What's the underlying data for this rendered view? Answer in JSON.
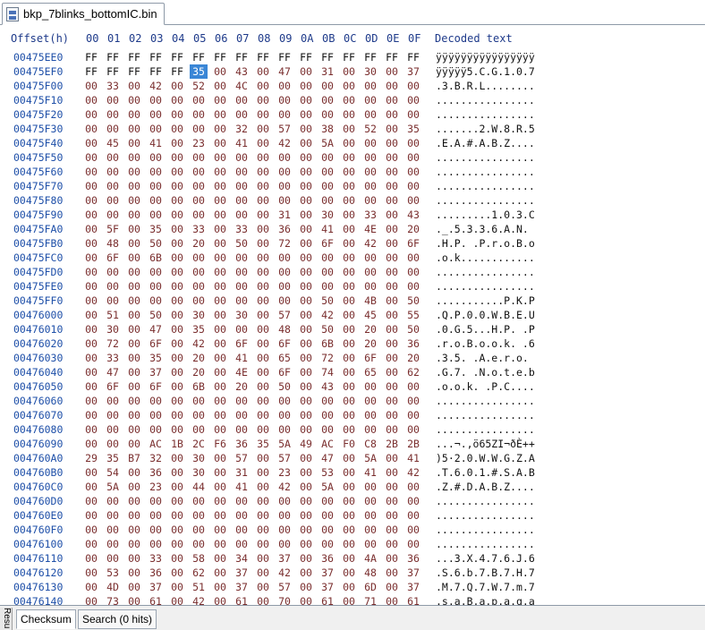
{
  "tab": {
    "title": "bkp_7blinks_bottomIC.bin",
    "icon": "binary-file-icon"
  },
  "header": {
    "offset_label": "Offset(h)",
    "columns": [
      "00",
      "01",
      "02",
      "03",
      "04",
      "05",
      "06",
      "07",
      "08",
      "09",
      "0A",
      "0B",
      "0C",
      "0D",
      "0E",
      "0F"
    ],
    "decoded_label": "Decoded text"
  },
  "selection": {
    "row": 1,
    "col": 5
  },
  "rows": [
    {
      "offset": "00475EE0",
      "bytes": "FF FF FF FF FF FF FF FF FF FF FF FF FF FF FF FF",
      "text": "ÿÿÿÿÿÿÿÿÿÿÿÿÿÿÿÿ"
    },
    {
      "offset": "00475EF0",
      "bytes": "FF FF FF FF FF 35 00 43 00 47 00 31 00 30 00 37",
      "text": "ÿÿÿÿÿ5.C.G.1.0.7"
    },
    {
      "offset": "00475F00",
      "bytes": "00 33 00 42 00 52 00 4C 00 00 00 00 00 00 00 00",
      "text": ".3.B.R.L........"
    },
    {
      "offset": "00475F10",
      "bytes": "00 00 00 00 00 00 00 00 00 00 00 00 00 00 00 00",
      "text": "................"
    },
    {
      "offset": "00475F20",
      "bytes": "00 00 00 00 00 00 00 00 00 00 00 00 00 00 00 00",
      "text": "................"
    },
    {
      "offset": "00475F30",
      "bytes": "00 00 00 00 00 00 00 32 00 57 00 38 00 52 00 35",
      "text": ".......2.W.8.R.5"
    },
    {
      "offset": "00475F40",
      "bytes": "00 45 00 41 00 23 00 41 00 42 00 5A 00 00 00 00",
      "text": ".E.A.#.A.B.Z...."
    },
    {
      "offset": "00475F50",
      "bytes": "00 00 00 00 00 00 00 00 00 00 00 00 00 00 00 00",
      "text": "................"
    },
    {
      "offset": "00475F60",
      "bytes": "00 00 00 00 00 00 00 00 00 00 00 00 00 00 00 00",
      "text": "................"
    },
    {
      "offset": "00475F70",
      "bytes": "00 00 00 00 00 00 00 00 00 00 00 00 00 00 00 00",
      "text": "................"
    },
    {
      "offset": "00475F80",
      "bytes": "00 00 00 00 00 00 00 00 00 00 00 00 00 00 00 00",
      "text": "................"
    },
    {
      "offset": "00475F90",
      "bytes": "00 00 00 00 00 00 00 00 00 31 00 30 00 33 00 43",
      "text": ".........1.0.3.C"
    },
    {
      "offset": "00475FA0",
      "bytes": "00 5F 00 35 00 33 00 33 00 36 00 41 00 4E 00 20",
      "text": "._.5.3.3.6.A.N. "
    },
    {
      "offset": "00475FB0",
      "bytes": "00 48 00 50 00 20 00 50 00 72 00 6F 00 42 00 6F",
      "text": ".H.P. .P.r.o.B.o"
    },
    {
      "offset": "00475FC0",
      "bytes": "00 6F 00 6B 00 00 00 00 00 00 00 00 00 00 00 00",
      "text": ".o.k............"
    },
    {
      "offset": "00475FD0",
      "bytes": "00 00 00 00 00 00 00 00 00 00 00 00 00 00 00 00",
      "text": "................"
    },
    {
      "offset": "00475FE0",
      "bytes": "00 00 00 00 00 00 00 00 00 00 00 00 00 00 00 00",
      "text": "................"
    },
    {
      "offset": "00475FF0",
      "bytes": "00 00 00 00 00 00 00 00 00 00 00 50 00 4B 00 50",
      "text": "...........P.K.P"
    },
    {
      "offset": "00476000",
      "bytes": "00 51 00 50 00 30 00 30 00 57 00 42 00 45 00 55",
      "text": ".Q.P.0.0.W.B.E.U"
    },
    {
      "offset": "00476010",
      "bytes": "00 30 00 47 00 35 00 00 00 48 00 50 00 20 00 50",
      "text": ".0.G.5...H.P. .P"
    },
    {
      "offset": "00476020",
      "bytes": "00 72 00 6F 00 42 00 6F 00 6F 00 6B 00 20 00 36",
      "text": ".r.o.B.o.o.k. .6"
    },
    {
      "offset": "00476030",
      "bytes": "00 33 00 35 00 20 00 41 00 65 00 72 00 6F 00 20",
      "text": ".3.5. .A.e.r.o. "
    },
    {
      "offset": "00476040",
      "bytes": "00 47 00 37 00 20 00 4E 00 6F 00 74 00 65 00 62",
      "text": ".G.7. .N.o.t.e.b"
    },
    {
      "offset": "00476050",
      "bytes": "00 6F 00 6F 00 6B 00 20 00 50 00 43 00 00 00 00",
      "text": ".o.o.k. .P.C...."
    },
    {
      "offset": "00476060",
      "bytes": "00 00 00 00 00 00 00 00 00 00 00 00 00 00 00 00",
      "text": "................"
    },
    {
      "offset": "00476070",
      "bytes": "00 00 00 00 00 00 00 00 00 00 00 00 00 00 00 00",
      "text": "................"
    },
    {
      "offset": "00476080",
      "bytes": "00 00 00 00 00 00 00 00 00 00 00 00 00 00 00 00",
      "text": "................"
    },
    {
      "offset": "00476090",
      "bytes": "00 00 00 AC 1B 2C F6 36 35 5A 49 AC F0 C8 2B 2B",
      "text": "...¬.,ö65ZI¬ðÈ++"
    },
    {
      "offset": "004760A0",
      "bytes": "29 35 B7 32 00 30 00 57 00 57 00 47 00 5A 00 41",
      "text": ")5·2.0.W.W.G.Z.A"
    },
    {
      "offset": "004760B0",
      "bytes": "00 54 00 36 00 30 00 31 00 23 00 53 00 41 00 42",
      "text": ".T.6.0.1.#.S.A.B"
    },
    {
      "offset": "004760C0",
      "bytes": "00 5A 00 23 00 44 00 41 00 42 00 5A 00 00 00 00",
      "text": ".Z.#.D.A.B.Z...."
    },
    {
      "offset": "004760D0",
      "bytes": "00 00 00 00 00 00 00 00 00 00 00 00 00 00 00 00",
      "text": "................"
    },
    {
      "offset": "004760E0",
      "bytes": "00 00 00 00 00 00 00 00 00 00 00 00 00 00 00 00",
      "text": "................"
    },
    {
      "offset": "004760F0",
      "bytes": "00 00 00 00 00 00 00 00 00 00 00 00 00 00 00 00",
      "text": "................"
    },
    {
      "offset": "00476100",
      "bytes": "00 00 00 00 00 00 00 00 00 00 00 00 00 00 00 00",
      "text": "................"
    },
    {
      "offset": "00476110",
      "bytes": "00 00 00 33 00 58 00 34 00 37 00 36 00 4A 00 36",
      "text": "...3.X.4.7.6.J.6"
    },
    {
      "offset": "00476120",
      "bytes": "00 53 00 36 00 62 00 37 00 42 00 37 00 48 00 37",
      "text": ".S.6.b.7.B.7.H.7"
    },
    {
      "offset": "00476130",
      "bytes": "00 4D 00 37 00 51 00 37 00 57 00 37 00 6D 00 37",
      "text": ".M.7.Q.7.W.7.m.7"
    },
    {
      "offset": "00476140",
      "bytes": "00 73 00 61 00 42 00 61 00 70 00 61 00 71 00 61",
      "text": ".s.a.B.a.p.a.q.a"
    }
  ],
  "bottom": {
    "side_label": "Resu",
    "tabs": [
      {
        "label": "Checksum"
      },
      {
        "label": "Search (0 hits)"
      }
    ]
  }
}
